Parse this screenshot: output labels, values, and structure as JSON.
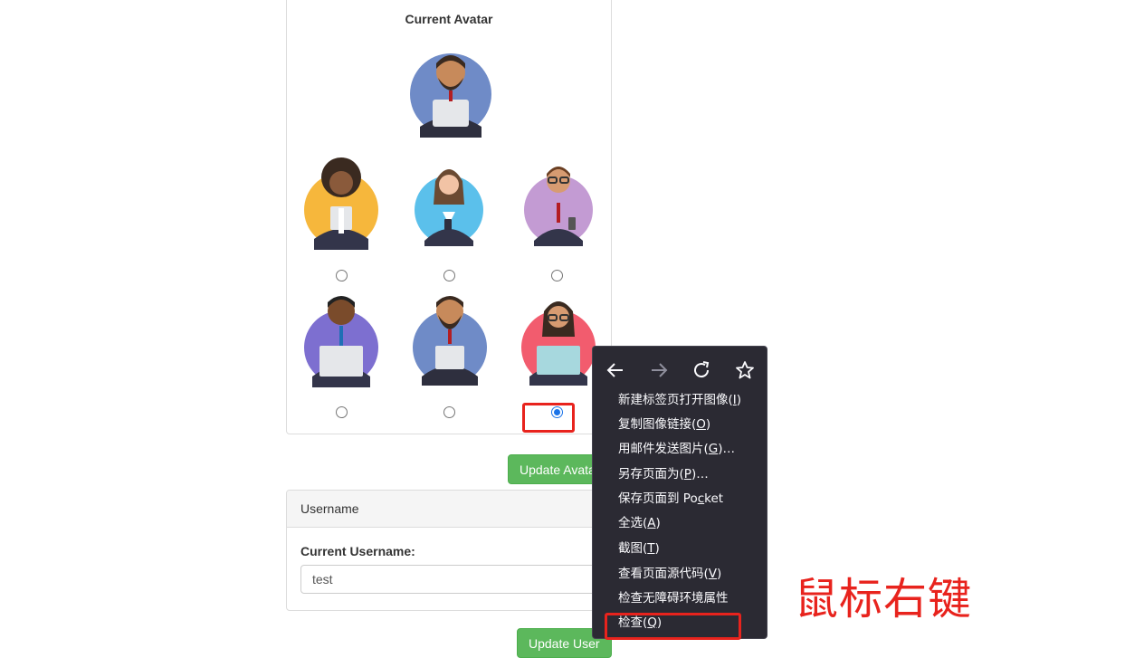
{
  "avatar_section": {
    "title": "Current Avatar",
    "selected_index": 5,
    "options": [
      {
        "name": "avatar-woman-curly",
        "bg": "#f6b73c"
      },
      {
        "name": "avatar-woman-phone",
        "bg": "#5bc0eb"
      },
      {
        "name": "avatar-man-glasses",
        "bg": "#c39bd3"
      },
      {
        "name": "avatar-man-laptop",
        "bg": "#7d6fd0"
      },
      {
        "name": "avatar-man-beard",
        "bg": "#6f8bc7"
      },
      {
        "name": "avatar-woman-laptop",
        "bg": "#f25c6e"
      }
    ],
    "update_button": "Update Avatar"
  },
  "username_section": {
    "heading": "Username",
    "label": "Current Username:",
    "value": "test",
    "update_button": "Update User"
  },
  "context_menu": {
    "items": [
      {
        "text": "新建标签页打开图像(",
        "key": "I",
        "suffix": ")"
      },
      {
        "text": "复制图像链接(",
        "key": "O",
        "suffix": ")"
      },
      {
        "text": "用邮件发送图片(",
        "key": "G",
        "suffix": ")…"
      },
      {
        "text": "另存页面为(",
        "key": "P",
        "suffix": ")…"
      },
      {
        "text": "保存页面到 Po",
        "key": "c",
        "suffix": "ket"
      },
      {
        "text": "全选(",
        "key": "A",
        "suffix": ")"
      },
      {
        "text": "截图(",
        "key": "T",
        "suffix": ")"
      },
      {
        "text": "查看页面源代码(",
        "key": "V",
        "suffix": ")"
      },
      {
        "text": "检查无障碍环境属性",
        "key": "",
        "suffix": ""
      },
      {
        "text": "检查(",
        "key": "Q",
        "suffix": ")"
      }
    ],
    "nav_icons": [
      "back-icon",
      "forward-icon",
      "reload-icon",
      "bookmark-star-icon"
    ]
  },
  "annotation": "鼠标右键",
  "colors": {
    "button_green": "#5cb85c",
    "highlight_red": "#e8231d",
    "menu_bg": "#2b2a33"
  }
}
